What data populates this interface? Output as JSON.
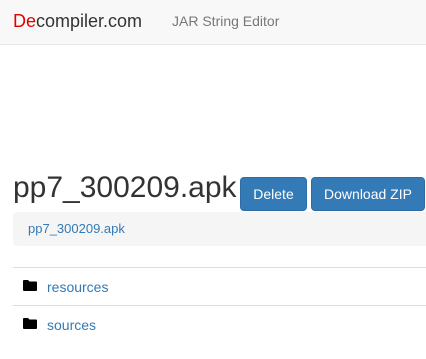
{
  "navbar": {
    "brand_accent": "De",
    "brand_rest": "compiler.com",
    "links": [
      {
        "label": "JAR String Editor"
      }
    ]
  },
  "header": {
    "title": "pp7_300209.apk",
    "delete_label": "Delete",
    "download_label": "Download ZIP"
  },
  "breadcrumb": {
    "items": [
      {
        "label": "pp7_300209.apk"
      }
    ]
  },
  "files": {
    "rows": [
      {
        "icon": "folder-icon",
        "name": "resources"
      },
      {
        "icon": "folder-icon",
        "name": "sources"
      }
    ]
  },
  "colors": {
    "brand_accent": "#e50000",
    "primary_button": "#337ab7",
    "link": "#337ab7",
    "navbar_bg": "#f8f8f8"
  }
}
